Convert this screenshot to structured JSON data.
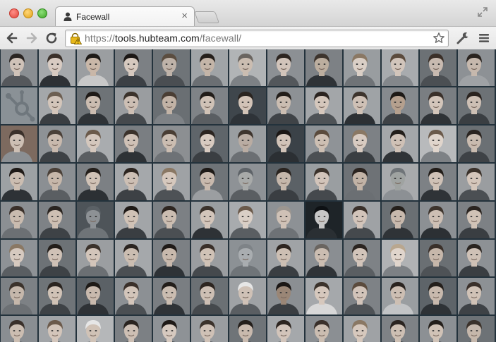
{
  "browser": {
    "tab_title": "Facewall",
    "tab_close": "×",
    "url_scheme": "https://",
    "url_host": "tools.hubteam.com",
    "url_path": "/facewall/"
  },
  "icons": {
    "tab": "person-icon",
    "back": "back-arrow-icon",
    "forward": "forward-arrow-icon",
    "reload": "reload-icon",
    "security": "warning-lock-icon",
    "bookmark": "star-icon",
    "wrench": "wrench-icon",
    "menu": "menu-icon",
    "fullscreen": "fullscreen-icon"
  },
  "colors": {
    "wall_background": "#23323c",
    "chrome_light": "#f3f3f3",
    "chrome_dark": "#d4d4d4"
  },
  "facewall": {
    "columns": 13,
    "rows": 8,
    "tiles": [
      {
        "bg": "#8a8e92",
        "skin": "#cfc2b8",
        "hair": "#2a2522",
        "shirt": "#55585c"
      },
      {
        "bg": "#a5a8ab",
        "skin": "#d8cbc2",
        "hair": "#3a302a",
        "shirt": "#2e3135"
      },
      {
        "bg": "#9b9ea1",
        "skin": "#c9b7a8",
        "hair": "#1e1a17",
        "shirt": "#c8c8c8"
      },
      {
        "bg": "#7c8084",
        "skin": "#d6c9bf",
        "hair": "#1b1715",
        "shirt": "#3c4045"
      },
      {
        "bg": "#6f7478",
        "skin": "#bfb3a9",
        "hair": "#5b4d40",
        "shirt": "#4a4e52"
      },
      {
        "bg": "#a0a4a7",
        "skin": "#c4b5a8",
        "hair": "#241f1b",
        "shirt": "#6b6f73"
      },
      {
        "bg": "#b1b4b6",
        "skin": "#cbbdb1",
        "hair": "#6a6560",
        "shirt": "#7d8185"
      },
      {
        "bg": "#8c9094",
        "skin": "#d2c4ba",
        "hair": "#2d2520",
        "shirt": "#53575b"
      },
      {
        "bg": "#7d8185",
        "skin": "#bcae9f",
        "hair": "#3d342d",
        "shirt": "#2e3236"
      },
      {
        "bg": "#999da0",
        "skin": "#dacfc6",
        "hair": "#8a7864",
        "shirt": "#6f7377"
      },
      {
        "bg": "#a8abae",
        "skin": "#d2c5bb",
        "hair": "#5b4b3d",
        "shirt": "#83878b"
      },
      {
        "bg": "#6c7175",
        "skin": "#c8bab0",
        "hair": "#3a2f28",
        "shirt": "#4b4f53"
      },
      {
        "bg": "#8d9195",
        "skin": "#c6b8ad",
        "hair": "#2a2420",
        "shirt": "#9fa2a5"
      },
      {
        "bg": "#8a9196",
        "skin": "#a3aab0",
        "hair": "#6f777d",
        "shirt": "#8d9499",
        "logo": true
      },
      {
        "bg": "#a4a7aa",
        "skin": "#d3c5ba",
        "hair": "#6d5f52",
        "shirt": "#3a3e42"
      },
      {
        "bg": "#6e7377",
        "skin": "#cbbcb0",
        "hair": "#1f1a17",
        "shirt": "#2f3337"
      },
      {
        "bg": "#9a9da0",
        "skin": "#cdbfb4",
        "hair": "#3b322b",
        "shirt": "#45494d"
      },
      {
        "bg": "#6a6f73",
        "skin": "#c2b3a6",
        "hair": "#4a3e34",
        "shirt": "#7e8286"
      },
      {
        "bg": "#7f8387",
        "skin": "#d0c2b6",
        "hair": "#221d19",
        "shirt": "#5a5e62"
      },
      {
        "bg": "#3f464c",
        "skin": "#d2c3b7",
        "hair": "#2a2420",
        "shirt": "#2e3338"
      },
      {
        "bg": "#8d9195",
        "skin": "#cbbdb1",
        "hair": "#231e1a",
        "shirt": "#3f4347"
      },
      {
        "bg": "#a3a6a9",
        "skin": "#d5c7bc",
        "hair": "#2b2420",
        "shirt": "#4e5256"
      },
      {
        "bg": "#9fa3a6",
        "skin": "#cfc1b6",
        "hair": "#3d342d",
        "shirt": "#2c3034"
      },
      {
        "bg": "#868a8e",
        "skin": "#b5a08e",
        "hair": "#1d1916",
        "shirt": "#3e4246"
      },
      {
        "bg": "#7a7e82",
        "skin": "#d3c5ba",
        "hair": "#3a302a",
        "shirt": "#2f3337"
      },
      {
        "bg": "#6d7276",
        "skin": "#cdbfb4",
        "hair": "#2a231f",
        "shirt": "#3a3e42"
      },
      {
        "bg": "#7d6a5f",
        "skin": "#cdbfb4",
        "hair": "#3a302a",
        "shirt": "#8b8f93"
      },
      {
        "bg": "#8e9296",
        "skin": "#c8b9ad",
        "hair": "#4a4038",
        "shirt": "#3d4145"
      },
      {
        "bg": "#a9acaf",
        "skin": "#d4c7bd",
        "hair": "#6b5a4b",
        "shirt": "#5a5e62"
      },
      {
        "bg": "#7a7e82",
        "skin": "#cfc1b6",
        "hair": "#3b322b",
        "shirt": "#2e3236"
      },
      {
        "bg": "#8c8f92",
        "skin": "#cbbdb1",
        "hair": "#4a3e34",
        "shirt": "#6e7276"
      },
      {
        "bg": "#5f656a",
        "skin": "#d7cac0",
        "hair": "#2b2420",
        "shirt": "#3a3e42"
      },
      {
        "bg": "#9a9ea1",
        "skin": "#b9aca2",
        "hair": "#3d342d",
        "shirt": "#6b6f73"
      },
      {
        "bg": "#3b4248",
        "skin": "#d1c3b8",
        "hair": "#1b1715",
        "shirt": "#2b2f33"
      },
      {
        "bg": "#8f9397",
        "skin": "#cdbfb3",
        "hair": "#5b4b3d",
        "shirt": "#4b4f53"
      },
      {
        "bg": "#7d8185",
        "skin": "#d8cbc1",
        "hair": "#8a7864",
        "shirt": "#3a3e42"
      },
      {
        "bg": "#a4a7aa",
        "skin": "#cfc1b6",
        "hair": "#231e1a",
        "shirt": "#2f3337"
      },
      {
        "bg": "#b8babc",
        "skin": "#e0d5cc",
        "hair": "#6b5a4b",
        "shirt": "#7d8185"
      },
      {
        "bg": "#6b7074",
        "skin": "#c9bbaf",
        "hair": "#2a2420",
        "shirt": "#3e4246"
      },
      {
        "bg": "#9da1a4",
        "skin": "#cbbdb1",
        "hair": "#1f1a17",
        "shirt": "#2e3236"
      },
      {
        "bg": "#8b8f93",
        "skin": "#c6b7aa",
        "hair": "#4a4038",
        "shirt": "#5a5e62"
      },
      {
        "bg": "#7c8084",
        "skin": "#d0c2b6",
        "hair": "#241f1b",
        "shirt": "#2c3034"
      },
      {
        "bg": "#a5a8ab",
        "skin": "#cdbfb4",
        "hair": "#2d2520",
        "shirt": "#3d4145"
      },
      {
        "bg": "#9fa2a5",
        "skin": "#d6c8bd",
        "hair": "#8a7864",
        "shirt": "#4e5256"
      },
      {
        "bg": "#6f7478",
        "skin": "#c8b9ad",
        "hair": "#1e1a17",
        "shirt": "#9b9ea1"
      },
      {
        "bg": "#8e9296",
        "skin": "#a8aaa9",
        "hair": "#5e6368",
        "shirt": "#5a5e62"
      },
      {
        "bg": "#5b6166",
        "skin": "#c5b7ab",
        "hair": "#2a2420",
        "shirt": "#3a3e42"
      },
      {
        "bg": "#9a9ea1",
        "skin": "#d2c4ba",
        "hair": "#3b322b",
        "shirt": "#45494d"
      },
      {
        "bg": "#6e7276",
        "skin": "#c2b3a6",
        "hair": "#2b2420",
        "shirt": "#6b6f73"
      },
      {
        "bg": "#a8aaac",
        "skin": "#9fa3a1",
        "hair": "#6f7478",
        "shirt": "#8c9094"
      },
      {
        "bg": "#7d8185",
        "skin": "#cfc1b6",
        "hair": "#221d19",
        "shirt": "#2f3337"
      },
      {
        "bg": "#9a9da0",
        "skin": "#d4c6bb",
        "hair": "#3b322b",
        "shirt": "#4b4f53"
      },
      {
        "bg": "#8b8f93",
        "skin": "#c9bbaf",
        "hair": "#3a302a",
        "shirt": "#6c7074"
      },
      {
        "bg": "#7e8286",
        "skin": "#cdbfb3",
        "hair": "#2a2420",
        "shirt": "#3e4246"
      },
      {
        "bg": "#4e5459",
        "skin": "#8d9195",
        "hair": "#5b6166",
        "shirt": "#6f7478"
      },
      {
        "bg": "#a2a5a8",
        "skin": "#d0c2b6",
        "hair": "#1f1a17",
        "shirt": "#3a3e42"
      },
      {
        "bg": "#7c8084",
        "skin": "#cbbdb1",
        "hair": "#2d2520",
        "shirt": "#4b4f53"
      },
      {
        "bg": "#9a9ea1",
        "skin": "#d3c5ba",
        "hair": "#3b322b",
        "shirt": "#2e3236"
      },
      {
        "bg": "#a8abae",
        "skin": "#dacfc6",
        "hair": "#6b5a4b",
        "shirt": "#5a5e62"
      },
      {
        "bg": "#8d9195",
        "skin": "#cfc1b6",
        "hair": "#9c9690",
        "shirt": "#6e7276"
      },
      {
        "bg": "#1e2428",
        "skin": "#c7c7c7",
        "hair": "#0e1114",
        "shirt": "#2a2f33"
      },
      {
        "bg": "#9fa2a5",
        "skin": "#d2c4ba",
        "hair": "#3a302a",
        "shirt": "#45494d"
      },
      {
        "bg": "#6a6f73",
        "skin": "#c8b9ad",
        "hair": "#241f1b",
        "shirt": "#2f3337"
      },
      {
        "bg": "#8c9094",
        "skin": "#cdbfb4",
        "hair": "#3d342d",
        "shirt": "#2c3034"
      },
      {
        "bg": "#7d8185",
        "skin": "#d0c2b6",
        "hair": "#2a2420",
        "shirt": "#3a3e42"
      },
      {
        "bg": "#8e9296",
        "skin": "#d6c9bf",
        "hair": "#8a7864",
        "shirt": "#5a5e62"
      },
      {
        "bg": "#6d7276",
        "skin": "#cfc1b6",
        "hair": "#231e1a",
        "shirt": "#3e4246"
      },
      {
        "bg": "#9b9ea1",
        "skin": "#d3c5ba",
        "hair": "#3b322b",
        "shirt": "#6b6f73"
      },
      {
        "bg": "#a5a8ab",
        "skin": "#cbbdb1",
        "hair": "#2a2420",
        "shirt": "#4b4f53"
      },
      {
        "bg": "#7c8084",
        "skin": "#c8b9ad",
        "hair": "#1f1a17",
        "shirt": "#2e3236"
      },
      {
        "bg": "#9a9da0",
        "skin": "#d0c2b6",
        "hair": "#3a302a",
        "shirt": "#45494d"
      },
      {
        "bg": "#8c9195",
        "skin": "#a9adb0",
        "hair": "#7e8387",
        "shirt": "#6f7478"
      },
      {
        "bg": "#a0a3a6",
        "skin": "#cdbfb3",
        "hair": "#2d2520",
        "shirt": "#3a3e42"
      },
      {
        "bg": "#8a8e92",
        "skin": "#cbbdb1",
        "hair": "#6a6560",
        "shirt": "#2f3337"
      },
      {
        "bg": "#7e8286",
        "skin": "#d2c4ba",
        "hair": "#2b2420",
        "shirt": "#5a5e62"
      },
      {
        "bg": "#b0b2b4",
        "skin": "#e0d5cc",
        "hair": "#b9a78f",
        "shirt": "#7d8185"
      },
      {
        "bg": "#6a6f73",
        "skin": "#c6b7aa",
        "hair": "#3a302a",
        "shirt": "#4e5256"
      },
      {
        "bg": "#8d9195",
        "skin": "#cfc1b6",
        "hair": "#2a2420",
        "shirt": "#3a3e42"
      },
      {
        "bg": "#7d8185",
        "skin": "#c5b7ab",
        "hair": "#3b322b",
        "shirt": "#6c7074"
      },
      {
        "bg": "#6f7478",
        "skin": "#d0c2b6",
        "hair": "#2a2420",
        "shirt": "#3e4246"
      },
      {
        "bg": "#5b6166",
        "skin": "#c8b9ad",
        "hair": "#1e1a17",
        "shirt": "#2e3236"
      },
      {
        "bg": "#8c9094",
        "skin": "#d3c5ba",
        "hair": "#3a302a",
        "shirt": "#4b4f53"
      },
      {
        "bg": "#7a7e82",
        "skin": "#cbbdb1",
        "hair": "#231e1a",
        "shirt": "#2f3337"
      },
      {
        "bg": "#6b7074",
        "skin": "#cdbfb4",
        "hair": "#2d2520",
        "shirt": "#45494d"
      },
      {
        "bg": "#9fa2a5",
        "skin": "#cfc1b6",
        "hair": "#e6e6e6",
        "shirt": "#5a5e62"
      },
      {
        "bg": "#8b8f93",
        "skin": "#9a8676",
        "hair": "#1b1715",
        "shirt": "#3a3e42"
      },
      {
        "bg": "#a5a8ab",
        "skin": "#d6c8bd",
        "hair": "#3b322b",
        "shirt": "#d8d8d8"
      },
      {
        "bg": "#7e8286",
        "skin": "#d2c4ba",
        "hair": "#5b4b3d",
        "shirt": "#4e5256"
      },
      {
        "bg": "#9a9ea1",
        "skin": "#cdbfb3",
        "hair": "#2a2420",
        "shirt": "#c2c4c6"
      },
      {
        "bg": "#5e6469",
        "skin": "#c8b9ad",
        "hair": "#241f1b",
        "shirt": "#2e3236"
      },
      {
        "bg": "#8d9195",
        "skin": "#d0c2b6",
        "hair": "#3a302a",
        "shirt": "#3e4246"
      },
      {
        "bg": "#8a8e92",
        "skin": "#cbbdb1",
        "hair": "#3a302a",
        "shirt": "#5a5e62"
      },
      {
        "bg": "#a2a5a8",
        "skin": "#d3c5ba",
        "hair": "#6b5a4b",
        "shirt": "#4b4f53"
      },
      {
        "bg": "#b5b7b9",
        "skin": "#d0c2b6",
        "hair": "#e6e6e6",
        "shirt": "#6c7074"
      },
      {
        "bg": "#7c8084",
        "skin": "#cdbfb4",
        "hair": "#2a2420",
        "shirt": "#3e4246"
      },
      {
        "bg": "#8e9296",
        "skin": "#d6c9bf",
        "hair": "#1f1a17",
        "shirt": "#2f3337"
      },
      {
        "bg": "#9a9da0",
        "skin": "#cfc1b6",
        "hair": "#3b322b",
        "shirt": "#45494d"
      },
      {
        "bg": "#6f7478",
        "skin": "#c8b9ad",
        "hair": "#231e1a",
        "shirt": "#3a3e42"
      },
      {
        "bg": "#a5a8ab",
        "skin": "#d2c4ba",
        "hair": "#2d2520",
        "shirt": "#5a5e62"
      },
      {
        "bg": "#8b8f93",
        "skin": "#cbbdb1",
        "hair": "#3a302a",
        "shirt": "#4e5256"
      },
      {
        "bg": "#9fa2a5",
        "skin": "#d6c8bd",
        "hair": "#8a7864",
        "shirt": "#6b6f73"
      },
      {
        "bg": "#7e8286",
        "skin": "#cdbfb3",
        "hair": "#2a2420",
        "shirt": "#2e3236"
      },
      {
        "bg": "#8c9094",
        "skin": "#d0c2b6",
        "hair": "#241f1b",
        "shirt": "#3e4246"
      },
      {
        "bg": "#6d7276",
        "skin": "#c5b7ab",
        "hair": "#3b322b",
        "shirt": "#4b4f53"
      }
    ]
  }
}
